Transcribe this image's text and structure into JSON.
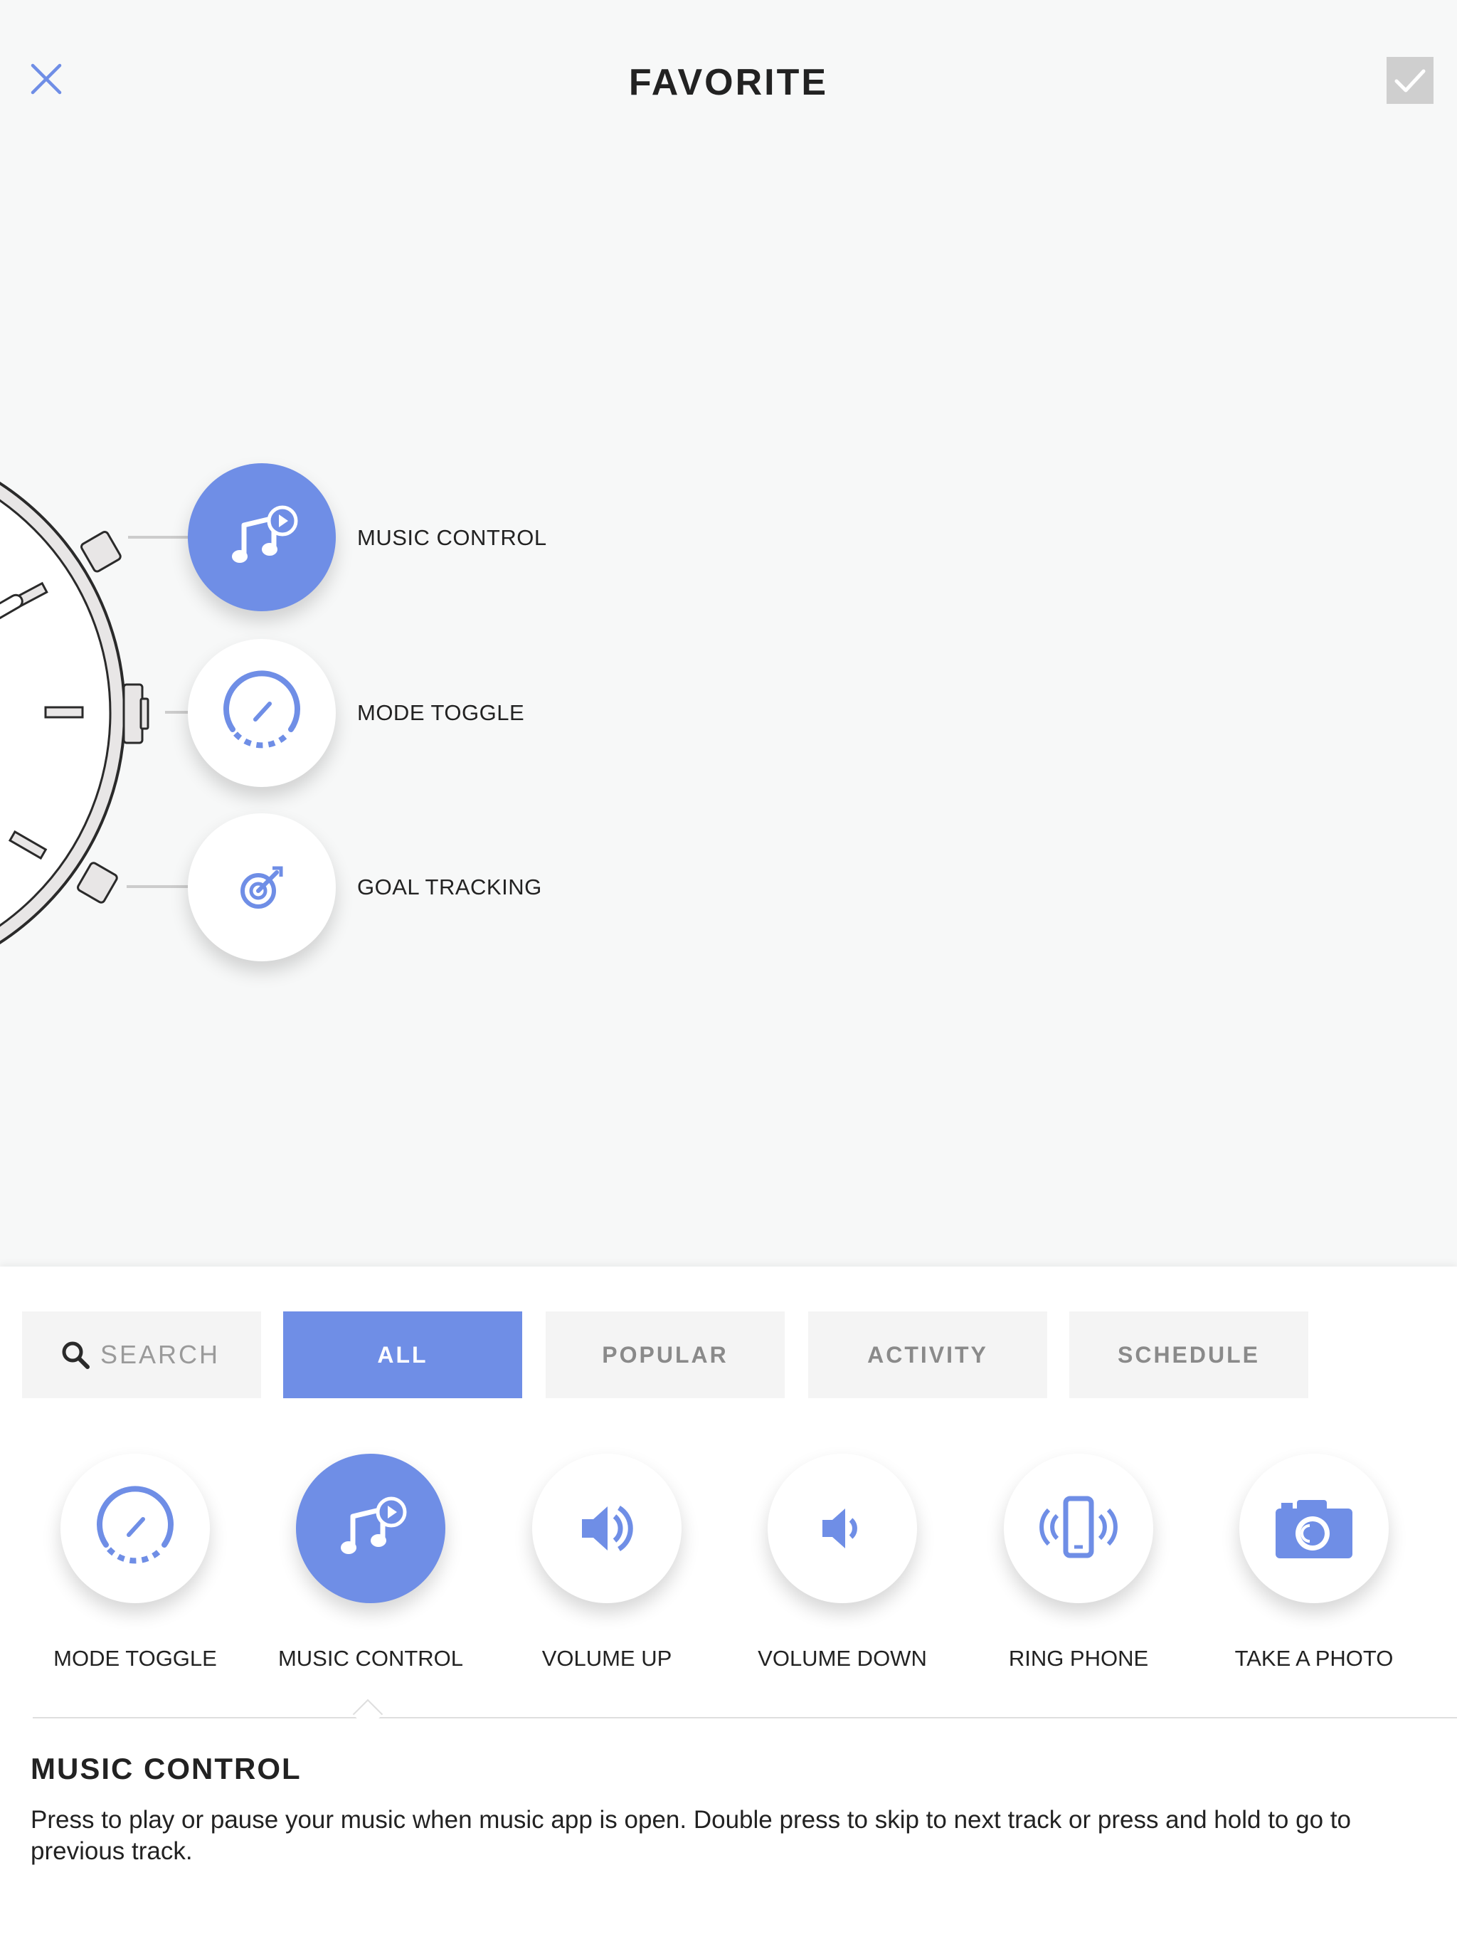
{
  "header": {
    "title": "FAVORITE"
  },
  "watch": {
    "slots": [
      {
        "label": "MUSIC CONTROL",
        "icon": "music-control-icon",
        "active": true
      },
      {
        "label": "MODE TOGGLE",
        "icon": "mode-toggle-icon",
        "active": false
      },
      {
        "label": "GOAL TRACKING",
        "icon": "goal-tracking-icon",
        "active": false
      }
    ]
  },
  "tabs": {
    "search": "SEARCH",
    "items": [
      "ALL",
      "POPULAR",
      "ACTIVITY",
      "SCHEDULE"
    ],
    "active": "ALL"
  },
  "functions": [
    {
      "label": "MODE TOGGLE",
      "icon": "mode-toggle-icon"
    },
    {
      "label": "MUSIC CONTROL",
      "icon": "music-control-icon",
      "selected": true
    },
    {
      "label": "VOLUME UP",
      "icon": "volume-up-icon"
    },
    {
      "label": "VOLUME DOWN",
      "icon": "volume-down-icon"
    },
    {
      "label": "RING PHONE",
      "icon": "ring-phone-icon"
    },
    {
      "label": "TAKE A PHOTO",
      "icon": "camera-icon"
    }
  ],
  "description": {
    "title": "MUSIC CONTROL",
    "text": "Press to play or pause your music when music app is open. Double press to skip to next track or press and hold to go to previous track."
  },
  "colors": {
    "accent": "#6f8ee6",
    "background": "#f7f8f8",
    "tab_bg": "#f4f4f4",
    "confirm_bg": "#cfcfcf"
  }
}
